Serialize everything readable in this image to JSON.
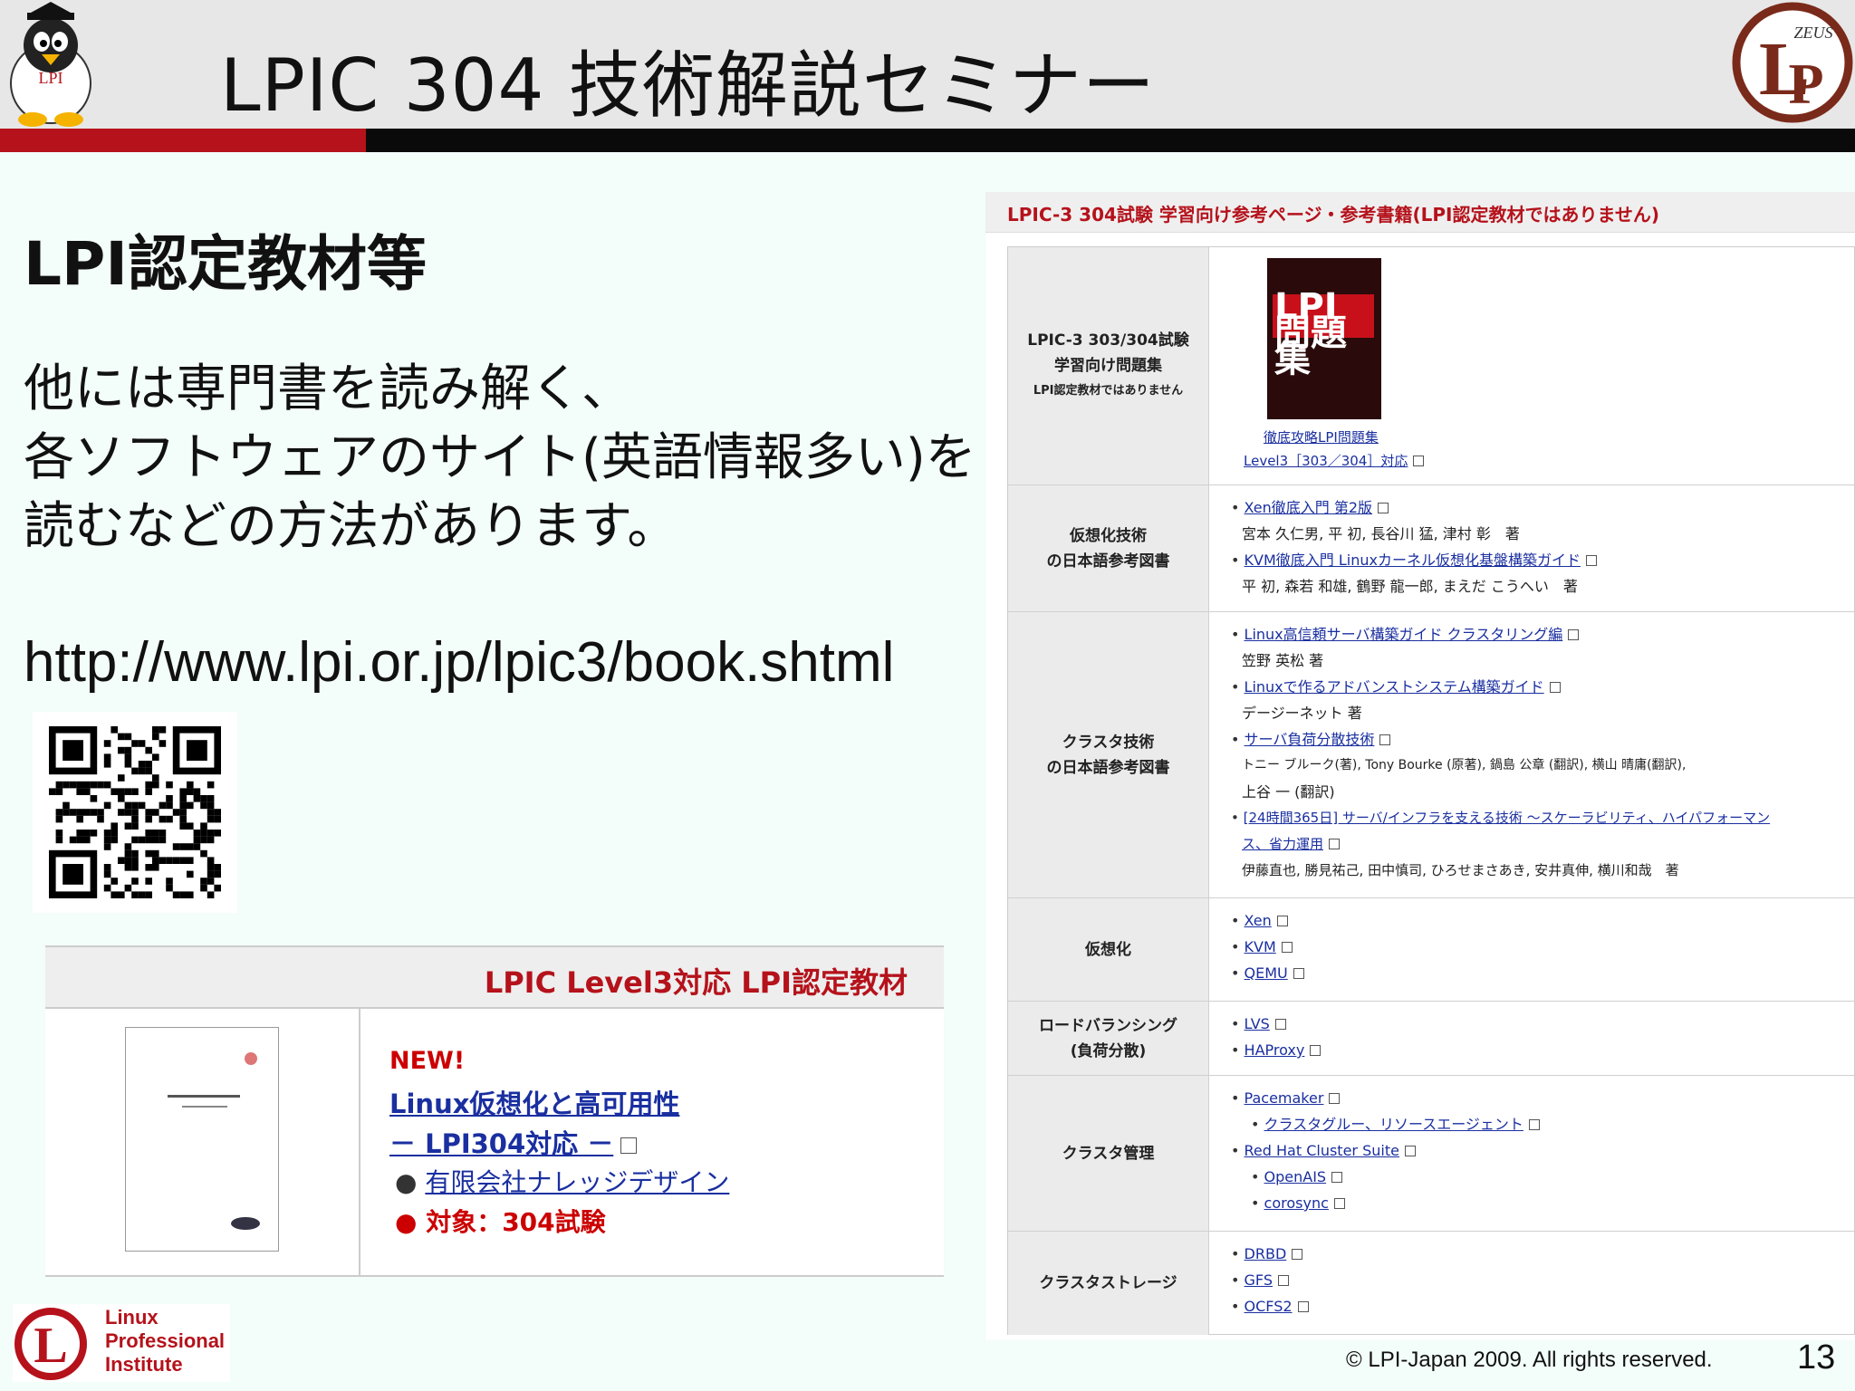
{
  "header": {
    "title": "LPIC 304 技術解説セミナー",
    "mascot_label": "LPI",
    "zeus_label": "ZEUS",
    "accent_red": "#b5121b"
  },
  "left": {
    "heading": "LPI認定教材等",
    "para_lines": [
      "他には専門書を読み解く、",
      "各ソフトウェアのサイト(英語情報多い)を",
      "読むなどの方法があります。"
    ],
    "url": "http://www.lpi.or.jp/lpic3/book.shtml",
    "qr_icon": "qr-code-icon"
  },
  "panel": {
    "title": "LPIC Level3対応 LPI認定教材",
    "new_tag": "NEW!",
    "book_title_1": "Linux仮想化と高可用性",
    "book_title_2": "－ LPI304対応 －",
    "publisher": "有限会社ナレッジデザイン",
    "target": "対象：304試験"
  },
  "right": {
    "header": "LPIC-3 304試験 学習向け参考ページ・参考書籍(LPI認定教材ではありません)",
    "rows": [
      {
        "label_lines": [
          "LPIC-3 303/304試験",
          "学習向け問題集",
          "LPI認定教材ではありません"
        ],
        "book_cover_text": "LPI 問題集",
        "book_link": "徹底攻略LPI問題集",
        "book_link2": "Level3［303／304］対応"
      },
      {
        "label_lines": [
          "仮想化技術",
          "の日本語参考図書"
        ],
        "items": [
          {
            "t": "Xen徹底入門 第2版",
            "a": "宮本 久仁男, 平 初, 長谷川 猛, 津村 彰　著"
          },
          {
            "t": "KVM徹底入門 Linuxカーネル仮想化基盤構築ガイド",
            "a": "平 初, 森若 和雄, 鶴野 龍一郎, まえだ こうへい　著"
          }
        ]
      },
      {
        "label_lines": [
          "クラスタ技術",
          "の日本語参考図書"
        ],
        "items": [
          {
            "t": "Linux高信頼サーバ構築ガイド クラスタリング編",
            "a": "笠野 英松 著"
          },
          {
            "t": "Linuxで作るアドバンストシステム構築ガイド",
            "a": "デージーネット 著"
          },
          {
            "t": "サーバ負荷分散技術",
            "a": "トニー ブルーク(著), Tony Bourke (原著), 鍋島 公章 (翻訳), 横山 晴庸(翻訳),",
            "a2": "上谷 一 (翻訳)"
          },
          {
            "t": "[24時間365日] サーバ/インフラを支える技術 ～スケーラビリティ、ハイパフォーマン",
            "t2": "ス、省力運用",
            "a": "伊藤直也, 勝見祐己, 田中慎司, ひろせまさあき, 安井真伸, 横川和哉　著"
          }
        ]
      },
      {
        "label_lines": [
          "仮想化"
        ],
        "items": [
          {
            "t": "Xen"
          },
          {
            "t": "KVM"
          },
          {
            "t": "QEMU"
          }
        ]
      },
      {
        "label_lines": [
          "ロードバランシング",
          "(負荷分散)"
        ],
        "items": [
          {
            "t": "LVS"
          },
          {
            "t": "HAProxy"
          }
        ]
      },
      {
        "label_lines": [
          "クラスタ管理"
        ],
        "items": [
          {
            "t": "Pacemaker"
          },
          {
            "t": "クラスタグルー、リソースエージェント",
            "sub": true
          },
          {
            "t": "Red Hat Cluster Suite"
          },
          {
            "t": "OpenAIS",
            "sub": true
          },
          {
            "t": "corosync",
            "sub": true
          }
        ]
      },
      {
        "label_lines": [
          "クラスタストレージ"
        ],
        "items": [
          {
            "t": "DRBD"
          },
          {
            "t": "GFS"
          },
          {
            "t": "OCFS2"
          }
        ]
      }
    ]
  },
  "footer": {
    "lpi_lines": [
      "Linux",
      "Professional",
      "Institute"
    ],
    "copyright": "© LPI-Japan 2009. All rights reserved.",
    "page": "13"
  }
}
